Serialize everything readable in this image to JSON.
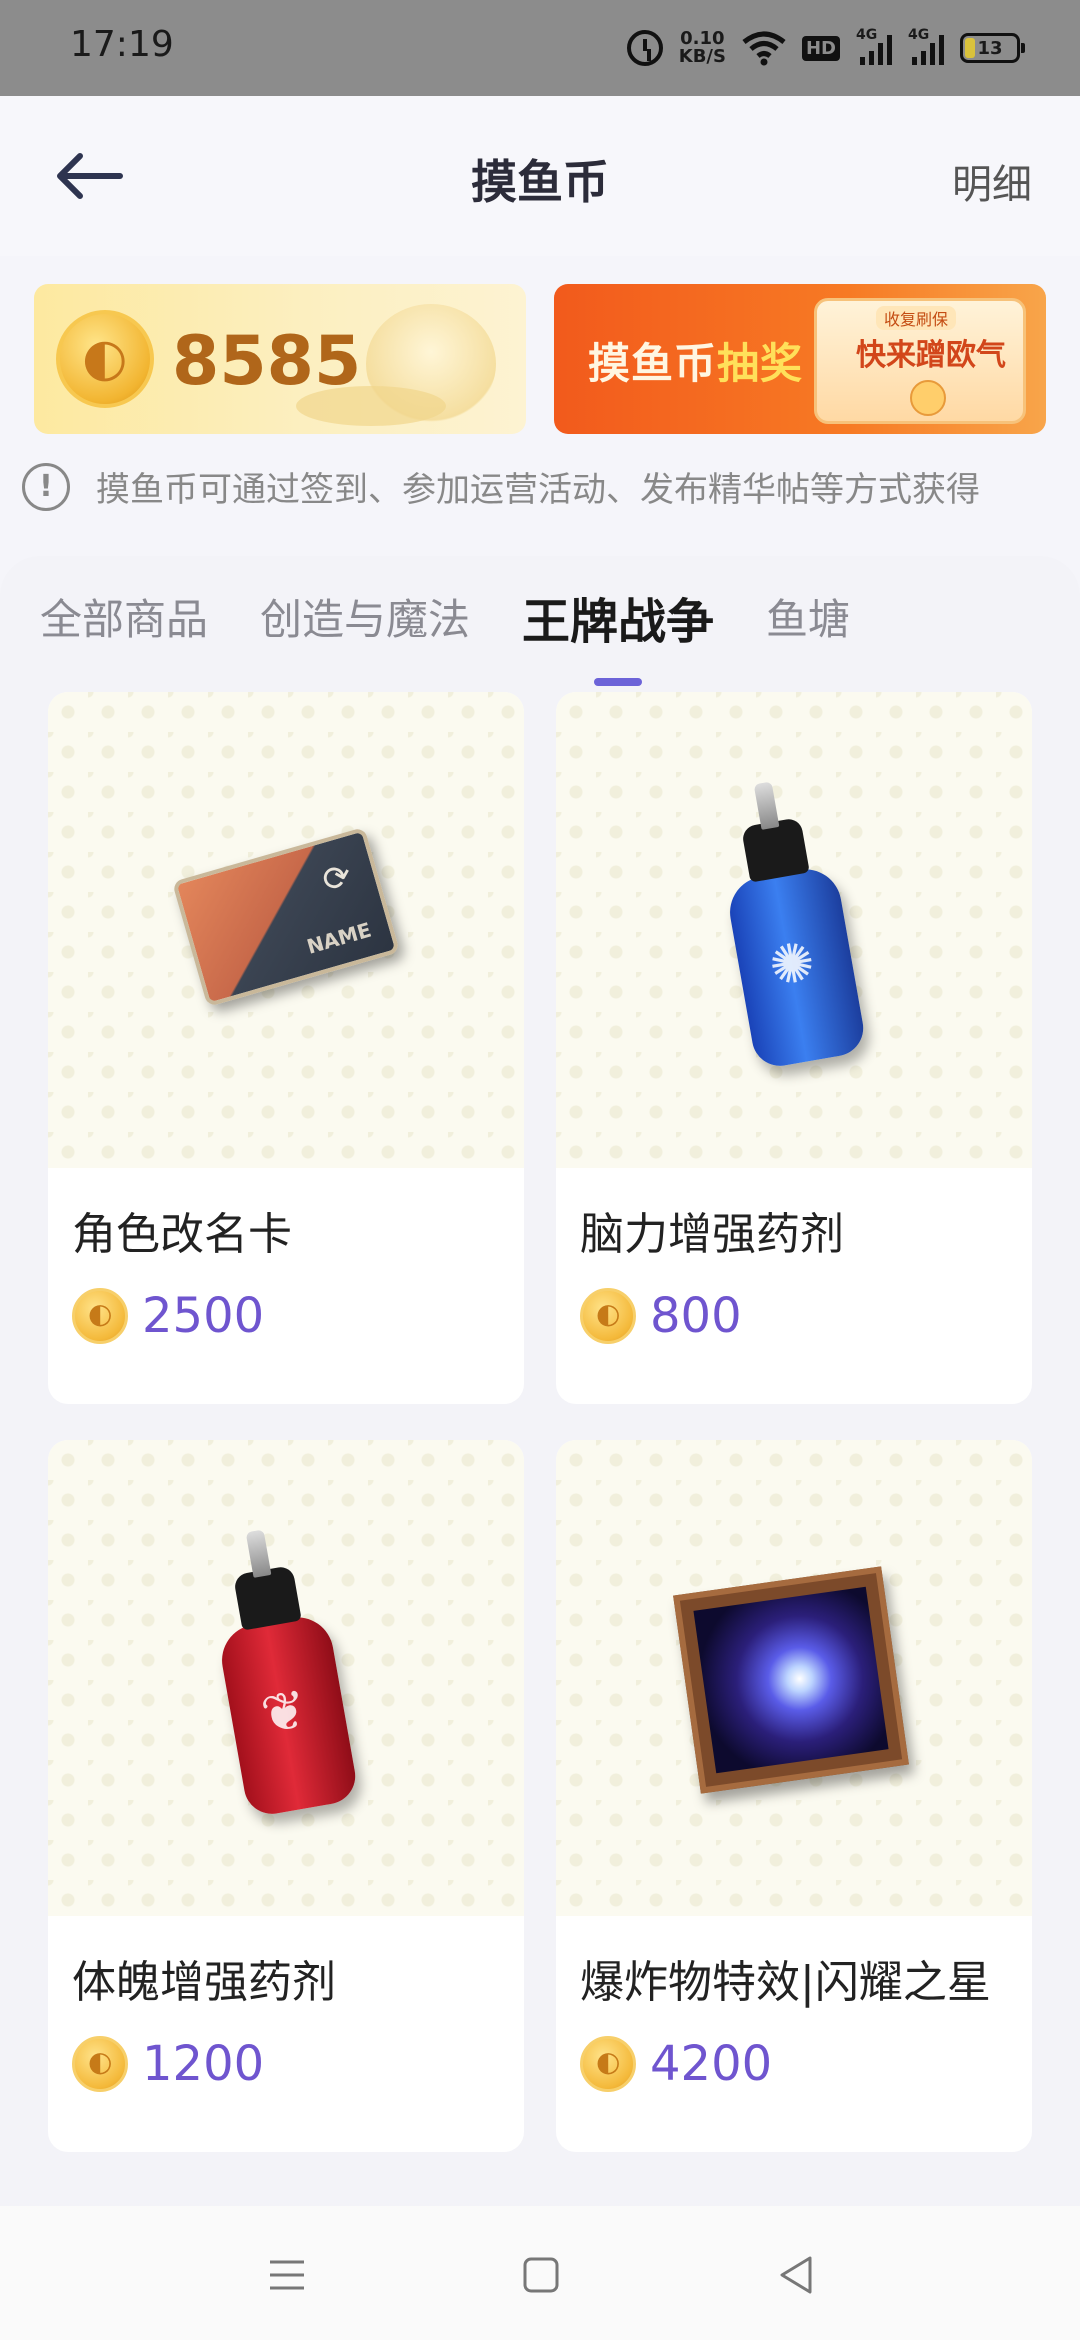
{
  "status_bar": {
    "time": "17:19",
    "net_speed_value": "0.10",
    "net_speed_unit": "KB/S",
    "hd_label": "HD",
    "signal1_label": "4G",
    "signal2_label": "4G",
    "battery_level": "13"
  },
  "header": {
    "title": "摸鱼币",
    "detail_label": "明细"
  },
  "coin_banner": {
    "balance": "8585"
  },
  "lottery_banner": {
    "title_prefix": "摸鱼币",
    "title_highlight": "抽奖",
    "tag": "收复刷保",
    "envelope_text": "快来蹭欧气"
  },
  "hint": {
    "icon": "!",
    "text": "摸鱼币可通过签到、参加运营活动、发布精华帖等方式获得"
  },
  "tabs": [
    {
      "label": "全部商品",
      "active": false
    },
    {
      "label": "创造与魔法",
      "active": false
    },
    {
      "label": "王牌战争",
      "active": true
    },
    {
      "label": "鱼塘",
      "active": false
    }
  ],
  "products": [
    {
      "name": "角色改名卡",
      "price": "2500",
      "image_label": "NAME"
    },
    {
      "name": "脑力增强药剂",
      "price": "800"
    },
    {
      "name": "体魄增强药剂",
      "price": "1200"
    },
    {
      "name": "爆炸物特效|闪耀之星",
      "price": "4200"
    }
  ],
  "colors": {
    "accent": "#6c63d8",
    "price": "#6f55cf",
    "lottery_banner": "#f25a1c",
    "coin_banner": "#fde9a0"
  },
  "icons": {
    "back": "back-arrow-icon",
    "coin": "fish-coin-icon",
    "hint": "info-icon",
    "nav_menu": "menu-icon",
    "nav_home": "home-icon",
    "nav_back": "back-triangle-icon"
  }
}
